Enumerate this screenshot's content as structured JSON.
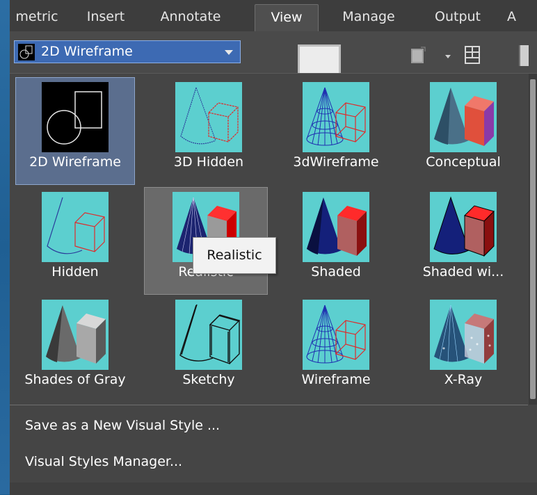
{
  "ribbon_tabs": [
    "metric",
    "Insert",
    "Annotate",
    "View",
    "Manage",
    "Output",
    "A"
  ],
  "active_tab": "View",
  "visual_style_combo": {
    "value": "2D Wireframe"
  },
  "gallery": {
    "items": [
      {
        "label": "2D Wireframe",
        "icon": "2d-wireframe-thumbnail",
        "state": "selected"
      },
      {
        "label": "3D Hidden",
        "icon": "3d-hidden-thumbnail"
      },
      {
        "label": "3dWireframe",
        "icon": "3d-wireframe-thumbnail"
      },
      {
        "label": "Conceptual",
        "icon": "conceptual-thumbnail"
      },
      {
        "label": "Hidden",
        "icon": "hidden-thumbnail"
      },
      {
        "label": "Realistic",
        "icon": "realistic-thumbnail",
        "state": "hover"
      },
      {
        "label": "Shaded",
        "icon": "shaded-thumbnail"
      },
      {
        "label": "Shaded wi...",
        "icon": "shaded-with-edges-thumbnail"
      },
      {
        "label": "Shades of Gray",
        "icon": "shades-of-gray-thumbnail"
      },
      {
        "label": "Sketchy",
        "icon": "sketchy-thumbnail"
      },
      {
        "label": "Wireframe",
        "icon": "wireframe-thumbnail"
      },
      {
        "label": "X-Ray",
        "icon": "x-ray-thumbnail"
      }
    ],
    "menu": {
      "save_new": "Save as a New Visual Style ...",
      "manager": "Visual Styles Manager..."
    }
  },
  "tooltip": {
    "text": "Realistic"
  },
  "colors": {
    "thumb_bg": "#5ccfcf",
    "selected_bg": "#5b6e8e",
    "combo_bg": "#3d6ab3",
    "panel_bg": "#454545"
  }
}
